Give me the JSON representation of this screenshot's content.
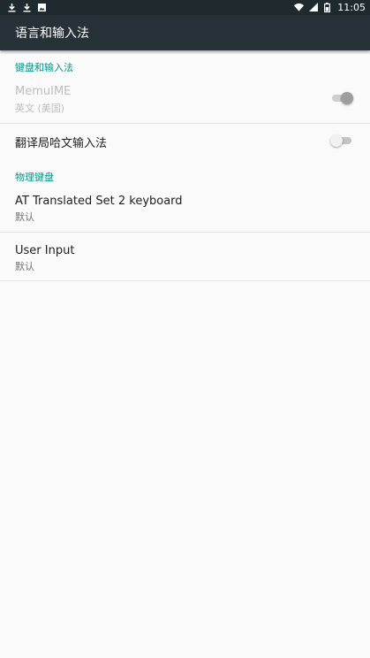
{
  "status_bar": {
    "left_icons": [
      "download-icon",
      "download-icon",
      "image-notification-icon"
    ],
    "right_icons": [
      "wifi-icon",
      "signal-icon",
      "battery-icon"
    ],
    "time": "11:05"
  },
  "app_bar": {
    "title": "语言和输入法"
  },
  "sections": [
    {
      "header": "键盘和输入法",
      "items": [
        {
          "title": "MemuIME",
          "subtitle": "英文 (美国)",
          "switch": "on",
          "enabled": false
        },
        {
          "title": "翻译局哈文输入法",
          "switch": "off",
          "enabled": true
        }
      ]
    },
    {
      "header": "物理键盘",
      "items": [
        {
          "title": "AT Translated Set 2 keyboard",
          "subtitle": "默认"
        },
        {
          "title": "User Input",
          "subtitle": "默认"
        }
      ]
    }
  ],
  "colors": {
    "status_bar": "#1f2a2e",
    "app_bar": "#263238",
    "accent": "#009688",
    "background": "#fafafa"
  }
}
